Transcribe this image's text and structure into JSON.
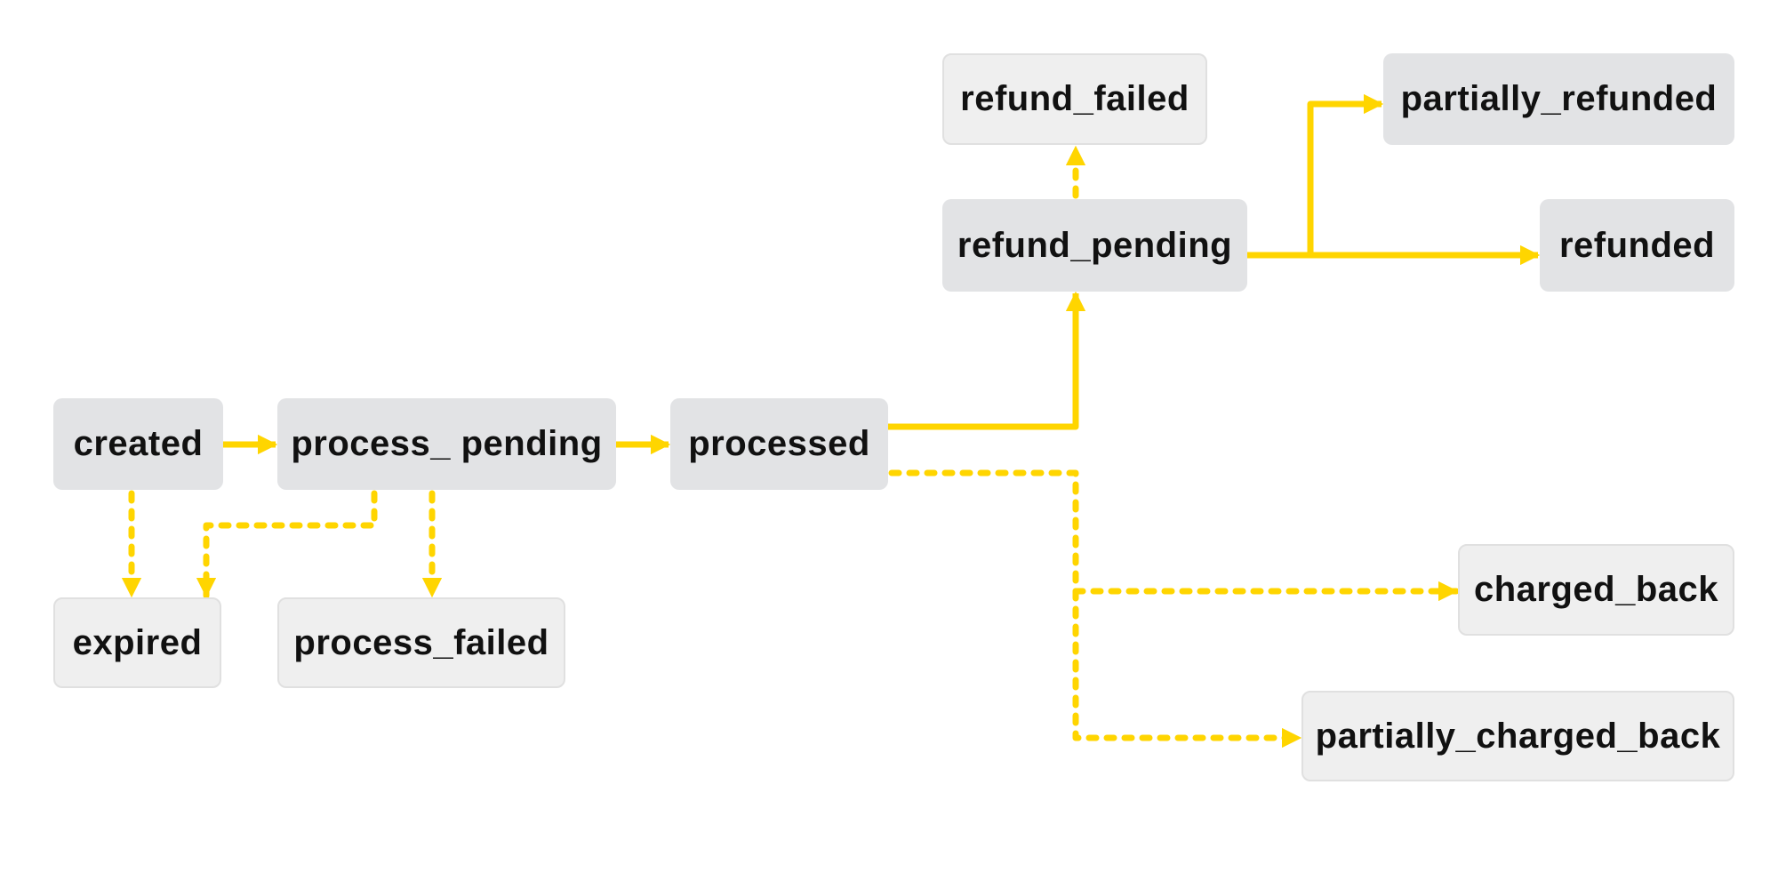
{
  "diagram": {
    "type": "state-machine",
    "edge_color": "#FFD500",
    "node_colors": {
      "primary": "#e2e3e5",
      "terminal": "#efefef",
      "text": "#111111"
    },
    "nodes": [
      {
        "id": "created",
        "label": "created",
        "kind": "primary"
      },
      {
        "id": "process_pending",
        "label": "process_ pending",
        "kind": "primary"
      },
      {
        "id": "processed",
        "label": "processed",
        "kind": "primary"
      },
      {
        "id": "refund_failed",
        "label": "refund_failed",
        "kind": "terminal"
      },
      {
        "id": "refund_pending",
        "label": "refund_pending",
        "kind": "primary"
      },
      {
        "id": "partially_refunded",
        "label": "partially_refunded",
        "kind": "primary"
      },
      {
        "id": "refunded",
        "label": "refunded",
        "kind": "primary"
      },
      {
        "id": "expired",
        "label": "expired",
        "kind": "terminal"
      },
      {
        "id": "process_failed",
        "label": "process_failed",
        "kind": "terminal"
      },
      {
        "id": "charged_back",
        "label": "charged_back",
        "kind": "terminal"
      },
      {
        "id": "partially_charged_back",
        "label": "partially_charged_back",
        "kind": "terminal"
      }
    ],
    "edges": [
      {
        "from": "created",
        "to": "process_pending",
        "style": "solid"
      },
      {
        "from": "process_pending",
        "to": "processed",
        "style": "solid"
      },
      {
        "from": "processed",
        "to": "refund_pending",
        "style": "solid"
      },
      {
        "from": "refund_pending",
        "to": "partially_refunded",
        "style": "solid"
      },
      {
        "from": "refund_pending",
        "to": "refunded",
        "style": "solid"
      },
      {
        "from": "refund_pending",
        "to": "refund_failed",
        "style": "dashed"
      },
      {
        "from": "created",
        "to": "expired",
        "style": "dashed"
      },
      {
        "from": "process_pending",
        "to": "expired",
        "style": "dashed"
      },
      {
        "from": "process_pending",
        "to": "process_failed",
        "style": "dashed"
      },
      {
        "from": "processed",
        "to": "charged_back",
        "style": "dashed"
      },
      {
        "from": "processed",
        "to": "partially_charged_back",
        "style": "dashed"
      }
    ]
  }
}
